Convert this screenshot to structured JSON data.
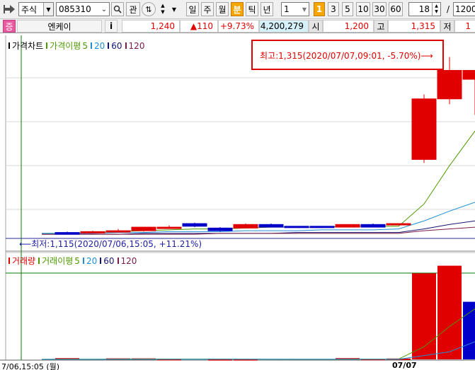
{
  "toolbar": {
    "market": "주식",
    "code": "085310",
    "gwan_label": "관",
    "period_buttons": [
      "일",
      "주",
      "월",
      "분",
      "틱",
      "년"
    ],
    "active_period": "분",
    "interval_value": "1",
    "minute_buttons": [
      "1",
      "3",
      "5",
      "10",
      "30",
      "60"
    ],
    "active_minute": "1",
    "count_value": "18",
    "count_divider": "/",
    "count_total": "1200"
  },
  "infobar": {
    "badge": "증",
    "stock_name": "엔케이",
    "info_button": "i",
    "price": "1,240",
    "change": "▲110",
    "change_rate": "+9.73%",
    "volume": "4,200,279",
    "open_label": "시",
    "open_value": "1,200",
    "high_label": "고",
    "high_value": "1,315",
    "low_label": "저",
    "low_value": "1"
  },
  "colors": {
    "up": "#e10000",
    "down": "#0000c8",
    "ma5": "#4c9a00",
    "ma20": "#1e8fd6",
    "ma60": "#14146e",
    "ma120": "#7a1a4a"
  },
  "price_panel": {
    "title": "가격차트",
    "ma_label": "가격이평",
    "ma_periods": [
      "5",
      "20",
      "60",
      "120"
    ],
    "high_annotation": "최고:1,315(2020/07/07,09:01, -5.70%)⟶",
    "low_annotation": "⟵최저:1,115(2020/07/06,15:05, +11.21%)"
  },
  "volume_panel": {
    "title": "거래량",
    "ma_label": "거래이평",
    "ma_periods": [
      "5",
      "20",
      "60",
      "120"
    ]
  },
  "x_axis": {
    "left_label": "7/06,15:05 (월)",
    "date_label": "07/07"
  },
  "chart_data": {
    "type": "candlestick",
    "price_candles": [
      {
        "o": 1118,
        "h": 1119,
        "l": 1116,
        "c": 1116
      },
      {
        "o": 1119,
        "h": 1120,
        "l": 1118,
        "c": 1119
      },
      {
        "o": 1119,
        "h": 1122,
        "l": 1118,
        "c": 1120
      },
      {
        "o": 1120,
        "h": 1124,
        "l": 1119,
        "c": 1124
      },
      {
        "o": 1124,
        "h": 1126,
        "l": 1123,
        "c": 1124
      },
      {
        "o": 1128,
        "h": 1129,
        "l": 1124,
        "c": 1125
      },
      {
        "o": 1123,
        "h": 1124,
        "l": 1119,
        "c": 1120
      },
      {
        "o": 1123,
        "h": 1128,
        "l": 1123,
        "c": 1127
      },
      {
        "o": 1127,
        "h": 1128,
        "l": 1124,
        "c": 1124
      },
      {
        "o": 1125,
        "h": 1125,
        "l": 1124,
        "c": 1124
      },
      {
        "o": 1125,
        "h": 1125,
        "l": 1124,
        "c": 1124
      },
      {
        "o": 1124,
        "h": 1127,
        "l": 1124,
        "c": 1127
      },
      {
        "o": 1127,
        "h": 1128,
        "l": 1124,
        "c": 1124
      },
      {
        "o": 1127,
        "h": 1128,
        "l": 1127,
        "c": 1128
      },
      {
        "o": 1200,
        "h": 1273,
        "l": 1196,
        "c": 1268
      },
      {
        "o": 1268,
        "h": 1315,
        "l": 1262,
        "c": 1300
      },
      {
        "o": 1290,
        "h": 1300,
        "l": 1250,
        "c": 1300
      }
    ],
    "volumes": [
      0,
      20000,
      0,
      16000,
      16000,
      6000,
      0,
      4000,
      4000,
      0,
      0,
      0,
      20000,
      8000,
      14000,
      1360000,
      1480000,
      910000
    ],
    "price_ma": {
      "ma5": [
        1117,
        1117,
        1118,
        1119,
        1120,
        1121,
        1122,
        1122,
        1123,
        1124,
        1124,
        1124,
        1125,
        1125,
        1125,
        1150,
        1193,
        1232
      ],
      "ma20": [
        1117,
        1117,
        1117,
        1118,
        1118,
        1119,
        1119,
        1119,
        1120,
        1120,
        1120,
        1121,
        1121,
        1121,
        1122,
        1131,
        1142,
        1152
      ],
      "ma60": [
        1116,
        1116,
        1116,
        1116,
        1117,
        1117,
        1117,
        1117,
        1117,
        1117,
        1118,
        1118,
        1118,
        1118,
        1118,
        1122,
        1127,
        1131
      ],
      "ma120": [
        1116,
        1116,
        1116,
        1116,
        1116,
        1116,
        1116,
        1117,
        1117,
        1117,
        1117,
        1117,
        1117,
        1117,
        1117,
        1120,
        1122,
        1124
      ]
    },
    "volume_ma": {
      "ma5": [
        2000,
        3000,
        3000,
        4000,
        5000,
        5000,
        5000,
        5000,
        4000,
        3000,
        2000,
        1000,
        2000,
        3000,
        5000,
        200000,
        520000,
        800000
      ],
      "ma20": [
        1000,
        1000,
        1000,
        2000,
        2000,
        2000,
        3000,
        3000,
        3000,
        3000,
        3000,
        3000,
        3000,
        3000,
        3000,
        60000,
        120000,
        280000
      ]
    }
  }
}
